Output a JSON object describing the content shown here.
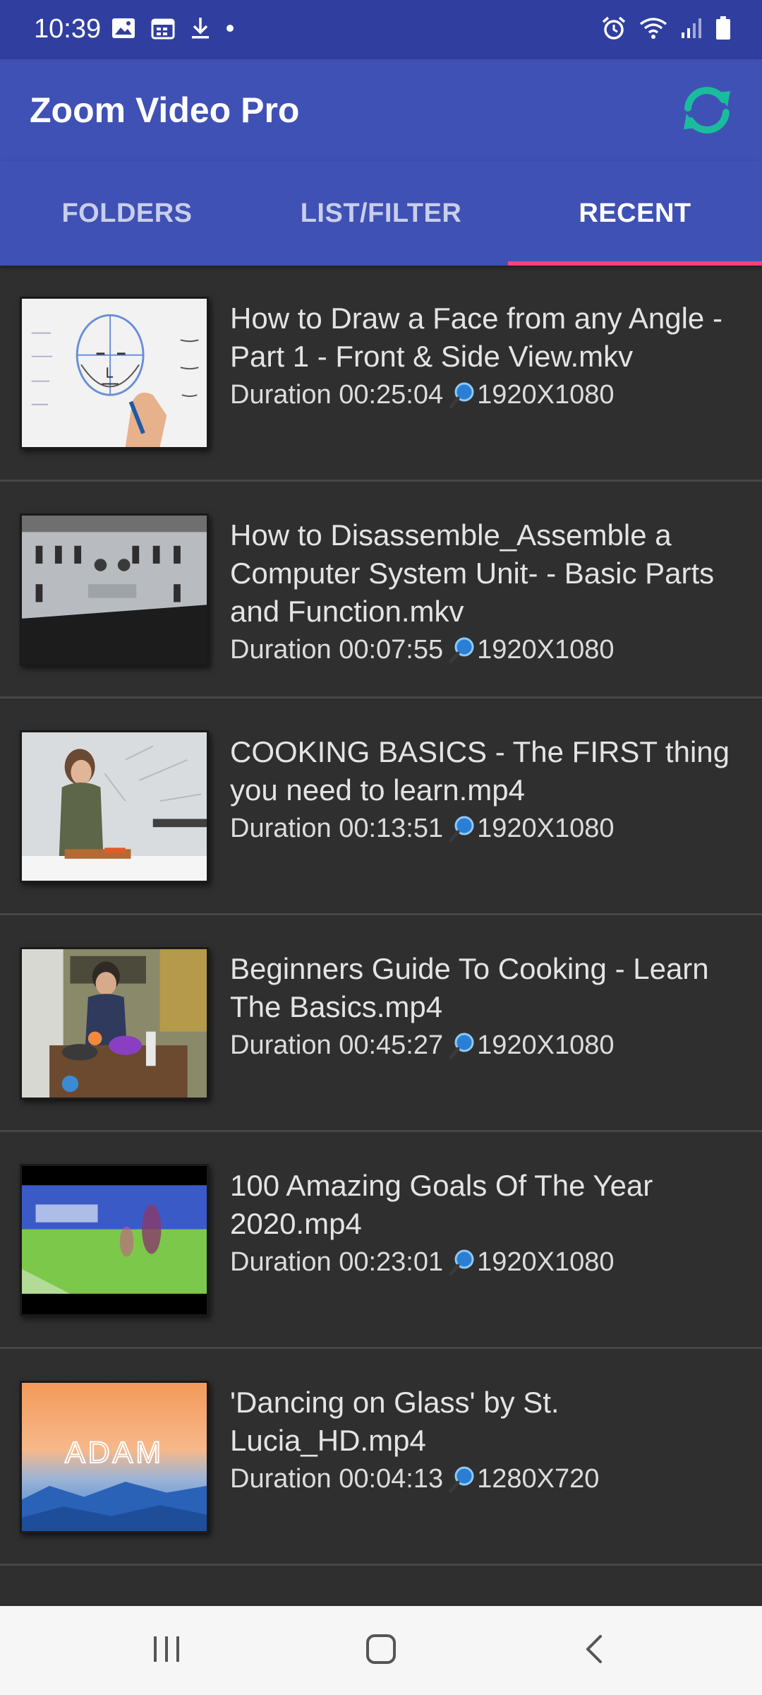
{
  "status_bar": {
    "time": "10:39",
    "left_icons": [
      "image-icon",
      "calendar-icon",
      "download-icon",
      "dot-icon"
    ],
    "right_icons": [
      "alarm-icon",
      "wifi-icon",
      "signal-icon",
      "battery-icon"
    ]
  },
  "app_bar": {
    "title": "Zoom Video Pro",
    "refresh_icon": "refresh-icon",
    "refresh_color": "#1abc9c"
  },
  "tabs": [
    {
      "label": "FOLDERS",
      "active": false
    },
    {
      "label": "LIST/FILTER",
      "active": false
    },
    {
      "label": "RECENT",
      "active": true
    }
  ],
  "colors": {
    "primary": "#3f51b5",
    "primary_dark": "#303f9f",
    "accent": "#ff4081",
    "list_bg": "#2f2f2f"
  },
  "duration_label": "Duration",
  "videos": [
    {
      "title_line1": "How to Draw a Face from any Angle -",
      "title_line2": "Part 1 - Front & Side View.mkv",
      "title_line3": "",
      "duration": "00:25:04",
      "resolution": "1920X1080"
    },
    {
      "title_line1": "How to Disassemble_Assemble a",
      "title_line2": "Computer System Unit- - Basic Parts",
      "title_line3": "and Function.mkv",
      "duration": "00:07:55",
      "resolution": "1920X1080"
    },
    {
      "title_line1": "COOKING BASICS - The FIRST thing",
      "title_line2": "you need to learn.mp4",
      "title_line3": "",
      "duration": "00:13:51",
      "resolution": "1920X1080"
    },
    {
      "title_line1": "Beginners Guide To Cooking - Learn",
      "title_line2": "The Basics.mp4",
      "title_line3": "",
      "duration": "00:45:27",
      "resolution": "1920X1080"
    },
    {
      "title_line1": "100 Amazing Goals Of The Year",
      "title_line2": "2020.mp4",
      "title_line3": "",
      "duration": "00:23:01",
      "resolution": "1920X1080"
    },
    {
      "title_line1": "'Dancing on Glass' by St.",
      "title_line2": "Lucia_HD.mp4",
      "title_line3": "",
      "duration": "00:04:13",
      "resolution": "1280X720"
    }
  ],
  "thumbnail_text": {
    "adam": "ADAM"
  },
  "nav_bar": {
    "icons": [
      "recent-apps-icon",
      "home-icon",
      "back-icon"
    ]
  }
}
